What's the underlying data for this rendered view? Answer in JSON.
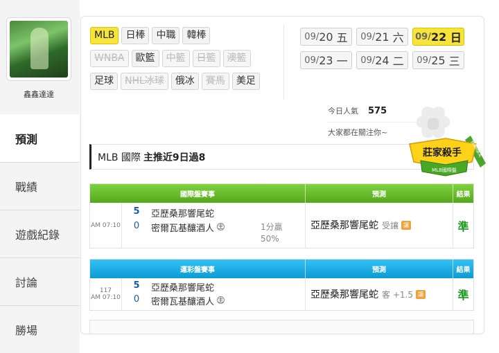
{
  "user": {
    "name": "鑫鑫達達",
    "avatar": "avatar-image"
  },
  "sidebar": {
    "items": [
      {
        "label": "預測",
        "active": true
      },
      {
        "label": "戰績"
      },
      {
        "label": "遊戲紀錄"
      },
      {
        "label": "討論"
      },
      {
        "label": "勝場"
      }
    ]
  },
  "leagues": {
    "rows": [
      [
        {
          "label": "MLB",
          "state": "active"
        },
        {
          "label": "日棒"
        },
        {
          "label": "中職"
        },
        {
          "label": "韓棒"
        }
      ],
      [
        {
          "label": "WNBA",
          "state": "disabled"
        },
        {
          "label": "歐籃"
        },
        {
          "label": "中籃",
          "state": "disabled"
        },
        {
          "label": "日籃",
          "state": "disabled"
        },
        {
          "label": "澳籃",
          "state": "disabled"
        }
      ],
      [
        {
          "label": "足球"
        },
        {
          "label": "NHL冰球",
          "state": "disabled"
        },
        {
          "label": "俄冰"
        },
        {
          "label": "賽馬",
          "state": "disabled"
        },
        {
          "label": "美足"
        }
      ]
    ]
  },
  "dates": {
    "rows": [
      [
        {
          "md": "09/",
          "d": "20",
          "wd": "五"
        },
        {
          "md": "09/",
          "d": "21",
          "wd": "六"
        },
        {
          "md": "09/",
          "d": "22",
          "wd": "日",
          "active": true
        }
      ],
      [
        {
          "md": "09/",
          "d": "23",
          "wd": "一"
        },
        {
          "md": "09/",
          "d": "24",
          "wd": "二"
        },
        {
          "md": "09/",
          "d": "25",
          "wd": "三"
        }
      ]
    ]
  },
  "popularity": {
    "label": "今日人氣",
    "value": "575",
    "attention": "大家都在關注你~"
  },
  "prediction": {
    "league": "MLB 國際",
    "streak": "主推近9日過8"
  },
  "badge": {
    "main": "莊家殺手",
    "sub": "MLB國際盤",
    "ribbon": "長期穩定"
  },
  "tables": [
    {
      "theme": "green",
      "header": {
        "game": "國際盤賽事",
        "pred": "預測",
        "result": "結果"
      },
      "time_top": "",
      "time": "AM 07:10",
      "teams": [
        {
          "score": "5",
          "name": "亞歷桑那響尾蛇",
          "win": true
        },
        {
          "score": "0",
          "name": "密爾瓦基釀酒人",
          "home": "主"
        }
      ],
      "ou": "1分贏",
      "pct": "50%",
      "pick": "亞歷桑那響尾蛇",
      "pick_sub": "受讓",
      "pick_tag": "讓",
      "result": "準"
    },
    {
      "theme": "blue",
      "header": {
        "game": "運彩盤賽事",
        "pred": "預測",
        "result": "結果"
      },
      "time_top": "117",
      "time": "AM 07:10",
      "teams": [
        {
          "score": "5",
          "name": "亞歷桑那響尾蛇",
          "win": true
        },
        {
          "score": "0",
          "name": "密爾瓦基釀酒人",
          "home": "主"
        }
      ],
      "ou": "",
      "pct": "",
      "pick": "亞歷桑那響尾蛇",
      "pick_sub": "客 +1.5",
      "pick_tag": "讓",
      "result": "準"
    }
  ]
}
